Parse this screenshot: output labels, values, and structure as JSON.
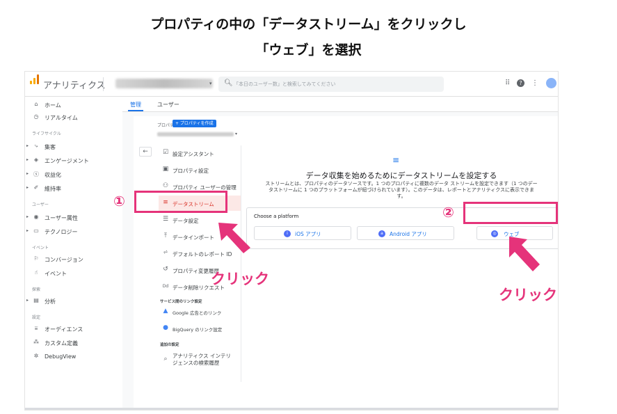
{
  "title_line1": "プロパティの中の「データストリーム」をクリックし",
  "title_line2": "「ウェブ」を選択",
  "app": {
    "name": "アナリティクス",
    "search_placeholder": "「本日のユーザー数」と検索してみてください"
  },
  "nav": {
    "home": "ホーム",
    "realtime": "リアルタイム",
    "sec_lifecycle": "ライフサイクル",
    "acquisition": "集客",
    "engagement": "エンゲージメント",
    "monetization": "収益化",
    "retention": "維持率",
    "sec_user": "ユーザー",
    "user_attributes": "ユーザー属性",
    "technology": "テクノロジー",
    "sec_event": "イベント",
    "conversions": "コンバージョン",
    "events": "イベント",
    "sec_explore": "探索",
    "analysis": "分析",
    "sec_configure": "設定",
    "audiences": "オーディエンス",
    "custom_definitions": "カスタム定義",
    "debugview": "DebugView",
    "admin": "管理"
  },
  "tabs": {
    "admin": "管理",
    "user": "ユーザー"
  },
  "property": {
    "label": "プロパティ",
    "create_button": "+ プロパティを作成"
  },
  "menu": {
    "setup_assistant": "設定アシスタント",
    "property_settings": "プロパティ設定",
    "property_user_mgmt": "プロパティ ユーザーの管理",
    "data_streams": "データストリーム",
    "data_settings": "データ設定",
    "data_import": "データインポート",
    "default_report_id": "デフォルトのレポート ID",
    "property_change_history": "プロパティ変更履歴",
    "data_deletion_requests": "データ削除リクエスト",
    "sec_product_links": "サービス間のリンク設定",
    "google_ads_links": "Google 広告とのリンク",
    "bigquery_links": "BigQuery のリンク設定",
    "sec_additional": "追加の設定",
    "analytics_intelligence_1": "アナリティクス インテリ",
    "analytics_intelligence_2": "ジェンスの検索履歴"
  },
  "streams": {
    "heading": "データ収集を始めるためにデータストリームを設定する",
    "desc1": "ストリームとは、プロパティのデータソースです。1 つのプロパティに複数のデータ ストリームを設定できます（1 つのデー",
    "desc2": "タストリームに 1 つのプラットフォームが紐づけられています）。このデータは、レポートとアナリティクスに表示できま",
    "desc3": "す。",
    "choose_platform": "Choose a platform",
    "ios": "iOS アプリ",
    "android": "Android アプリ",
    "web": "ウェブ"
  },
  "annotations": {
    "num1": "①",
    "num2": "②",
    "click1": "クリック",
    "click2": "クリック",
    "color": "#e5337a"
  }
}
